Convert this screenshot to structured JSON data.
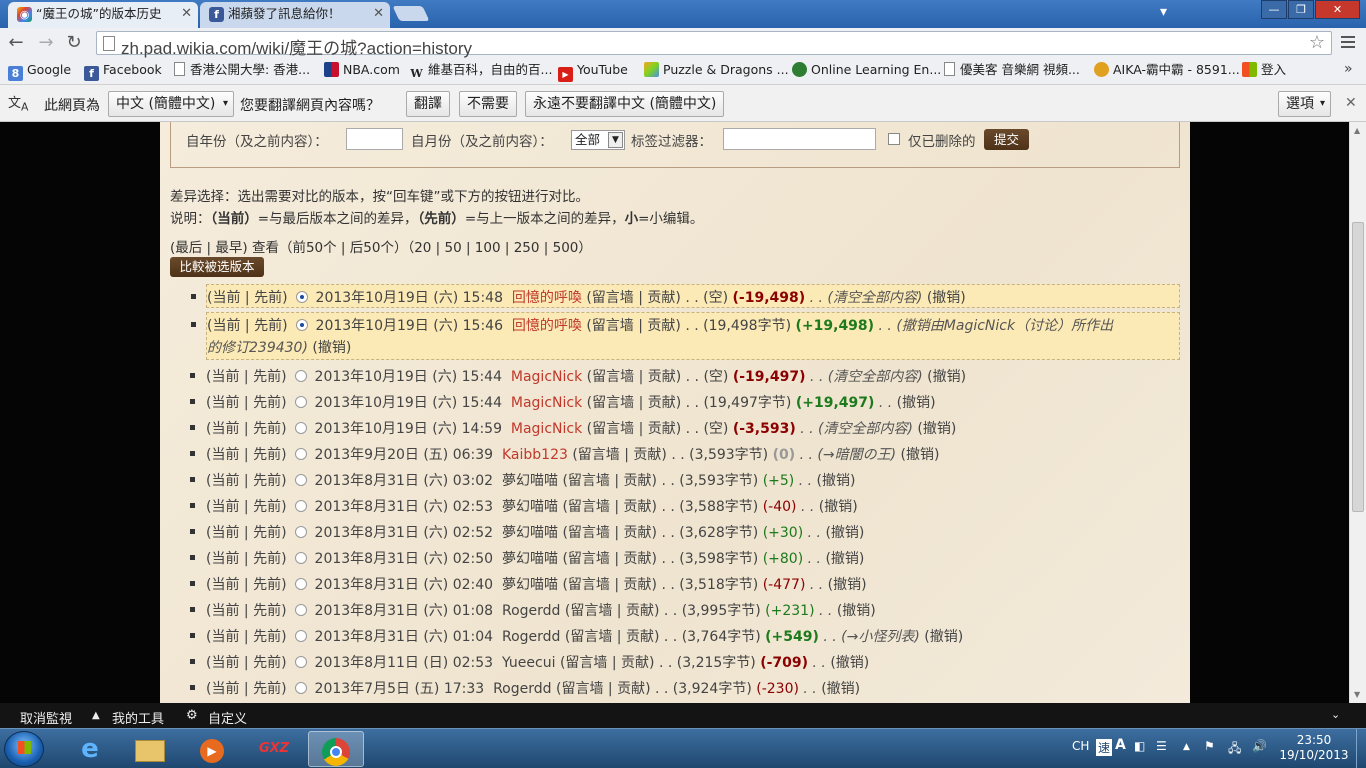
{
  "tabs": [
    {
      "title": "“魔王の城”的版本历史",
      "active": true
    },
    {
      "title": "湘蘋發了訊息給你！",
      "active": false
    }
  ],
  "window_buttons": {
    "minimize": "—",
    "maximize": "❐",
    "close": "✕"
  },
  "nav": {
    "back": "←",
    "forward": "→",
    "reload": "↻"
  },
  "url": "zh.pad.wikia.com/wiki/魔王の城?action=history",
  "bookmarks": [
    {
      "label": "Google",
      "icon": "google-icon"
    },
    {
      "label": "Facebook",
      "icon": "facebook-icon"
    },
    {
      "label": "香港公開大學: 香港...",
      "icon": "page-icon"
    },
    {
      "label": "NBA.com",
      "icon": "nba-icon"
    },
    {
      "label": "維基百科，自由的百...",
      "icon": "wikipedia-icon"
    },
    {
      "label": "YouTube",
      "icon": "youtube-icon"
    },
    {
      "label": "Puzzle & Dragons ...",
      "icon": "puzzle-dragons-icon"
    },
    {
      "label": "Online Learning En...",
      "icon": "online-learning-icon"
    },
    {
      "label": "優美客 音樂網 視頻...",
      "icon": "page-icon"
    },
    {
      "label": "AIKA-霸中霸 - 8591...",
      "icon": "aika-icon"
    },
    {
      "label": "登入",
      "icon": "microsoft-icon"
    }
  ],
  "translate_bar": {
    "prefix": "此網頁為",
    "language": "中文 (簡體中文)",
    "question": "您要翻譯網頁內容嗎？",
    "translate": "翻譯",
    "nope": "不需要",
    "never": "永遠不要翻譯中文 (簡體中文)",
    "options": "選項"
  },
  "filter": {
    "year_label": "自年份（及之前内容）：",
    "month_label": "自月份（及之前内容）：",
    "month_value": "全部",
    "tag_label": "标签过滤器：",
    "deleted_label": "仅已删除的",
    "submit": "提交"
  },
  "info": {
    "line1": "差异选择：选出需要对比的版本，按“回车键”或下方的按钮进行对比。",
    "line2_a": "说明：",
    "line2_b": "（当前）",
    "line2_c": "=与最后版本之间的差异，",
    "line2_d": "（先前）",
    "line2_e": "=与上一版本之间的差异，",
    "line2_f": "小",
    "line2_g": "=小编辑。",
    "nav_line": "(最后 | 最早) 查看（前50个 | 后50个）（20 | 50 | 100 | 250 | 500）",
    "compare_button": "比較被选版本"
  },
  "revisions": [
    {
      "links": "(当前 | 先前)",
      "radio": true,
      "date": "2013年10月19日 (六) 15:48",
      "user": "回憶的呼喚",
      "user_red": true,
      "talk": "(留言墙 | 贡献)",
      "size": ". . (空)",
      "diff": "(-19,498)",
      "diff_class": "neg",
      "comment": ". . (清空全部内容)",
      "undo": "(撤销)",
      "selected": true
    },
    {
      "links": "(当前 | 先前)",
      "radio": true,
      "date": "2013年10月19日 (六) 15:46",
      "user": "回憶的呼喚",
      "user_red": true,
      "talk": "(留言墙 | 贡献)",
      "size": ". . (19,498字节)",
      "diff": "(+19,498)",
      "diff_class": "pos",
      "comment": ". . (撤销由MagicNick（讨论）所作出",
      "comment2": "的修订239430)",
      "undo": "(撤销)",
      "selected": true
    },
    {
      "links": "(当前 | 先前)",
      "radio": false,
      "date": "2013年10月19日 (六) 15:44",
      "user": "MagicNick",
      "user_red": true,
      "talk": "(留言墙 | 贡献)",
      "size": ". . (空)",
      "diff": "(-19,497)",
      "diff_class": "neg",
      "comment": ". . (清空全部内容)",
      "undo": "(撤销)",
      "selected": false
    },
    {
      "links": "(当前 | 先前)",
      "radio": false,
      "date": "2013年10月19日 (六) 15:44",
      "user": "MagicNick",
      "user_red": true,
      "talk": "(留言墙 | 贡献)",
      "size": ". . (19,497字节)",
      "diff": "(+19,497)",
      "diff_class": "pos",
      "comment": ". .",
      "undo": "(撤销)",
      "selected": false
    },
    {
      "links": "(当前 | 先前)",
      "radio": false,
      "date": "2013年10月19日 (六) 14:59",
      "user": "MagicNick",
      "user_red": true,
      "talk": "(留言墙 | 贡献)",
      "size": ". . (空)",
      "diff": "(-3,593)",
      "diff_class": "neg",
      "comment": ". . (清空全部内容)",
      "undo": "(撤销)",
      "selected": false
    },
    {
      "links": "(当前 | 先前)",
      "radio": false,
      "date": "2013年9月20日 (五) 06:39",
      "user": "Kaibb123",
      "user_red": true,
      "talk": "(留言墙 | 贡献)",
      "size": ". . (3,593字节)",
      "diff": "(0)",
      "diff_class": "zero",
      "comment": ". . (→暗闇の王)",
      "undo": "(撤销)",
      "selected": false
    },
    {
      "links": "(当前 | 先前)",
      "radio": false,
      "date": "2013年8月31日 (六) 03:02",
      "user": "夢幻喵喵",
      "user_red": false,
      "talk": "(留言墙 | 贡献)",
      "size": ". . (3,593字节)",
      "diff": "(+5)",
      "diff_class": "pos small",
      "comment": ". .",
      "undo": "(撤销)",
      "selected": false
    },
    {
      "links": "(当前 | 先前)",
      "radio": false,
      "date": "2013年8月31日 (六) 02:53",
      "user": "夢幻喵喵",
      "user_red": false,
      "talk": "(留言墙 | 贡献)",
      "size": ". . (3,588字节)",
      "diff": "(-40)",
      "diff_class": "neg small",
      "comment": ". .",
      "undo": "(撤销)",
      "selected": false
    },
    {
      "links": "(当前 | 先前)",
      "radio": false,
      "date": "2013年8月31日 (六) 02:52",
      "user": "夢幻喵喵",
      "user_red": false,
      "talk": "(留言墙 | 贡献)",
      "size": ". . (3,628字节)",
      "diff": "(+30)",
      "diff_class": "pos small",
      "comment": ". .",
      "undo": "(撤销)",
      "selected": false
    },
    {
      "links": "(当前 | 先前)",
      "radio": false,
      "date": "2013年8月31日 (六) 02:50",
      "user": "夢幻喵喵",
      "user_red": false,
      "talk": "(留言墙 | 贡献)",
      "size": ". . (3,598字节)",
      "diff": "(+80)",
      "diff_class": "pos small",
      "comment": ". .",
      "undo": "(撤销)",
      "selected": false
    },
    {
      "links": "(当前 | 先前)",
      "radio": false,
      "date": "2013年8月31日 (六) 02:40",
      "user": "夢幻喵喵",
      "user_red": false,
      "talk": "(留言墙 | 贡献)",
      "size": ". . (3,518字节)",
      "diff": "(-477)",
      "diff_class": "neg small",
      "comment": ". .",
      "undo": "(撤销)",
      "selected": false
    },
    {
      "links": "(当前 | 先前)",
      "radio": false,
      "date": "2013年8月31日 (六) 01:08",
      "user": "Rogerdd",
      "user_red": false,
      "talk": "(留言墙 | 贡献)",
      "size": ". . (3,995字节)",
      "diff": "(+231)",
      "diff_class": "pos small",
      "comment": ". .",
      "undo": "(撤销)",
      "selected": false
    },
    {
      "links": "(当前 | 先前)",
      "radio": false,
      "date": "2013年8月31日 (六) 01:04",
      "user": "Rogerdd",
      "user_red": false,
      "talk": "(留言墙 | 贡献)",
      "size": ". . (3,764字节)",
      "diff": "(+549)",
      "diff_class": "pos",
      "comment": ". . (→小怪列表)",
      "undo": "(撤销)",
      "selected": false
    },
    {
      "links": "(当前 | 先前)",
      "radio": false,
      "date": "2013年8月11日 (日) 02:53",
      "user": "Yueecui",
      "user_red": false,
      "talk": "(留言墙 | 贡献)",
      "size": ". . (3,215字节)",
      "diff": "(-709)",
      "diff_class": "neg",
      "comment": ". .",
      "undo": "(撤销)",
      "selected": false
    },
    {
      "links": "(当前 | 先前)",
      "radio": false,
      "date": "2013年7月5日 (五) 17:33",
      "user": "Rogerdd",
      "user_red": false,
      "talk": "(留言墙 | 贡献)",
      "size": ". . (3,924字节)",
      "diff": "(-230)",
      "diff_class": "neg small",
      "comment": ". .",
      "undo": "(撤销)",
      "selected": false
    }
  ],
  "wikia_bar": {
    "unfollow": "取消監視",
    "my_tools": "我的工具",
    "customize": "自定义"
  },
  "taskbar": {
    "lang": "CH",
    "time": "23:50",
    "date": "19/10/2013"
  }
}
